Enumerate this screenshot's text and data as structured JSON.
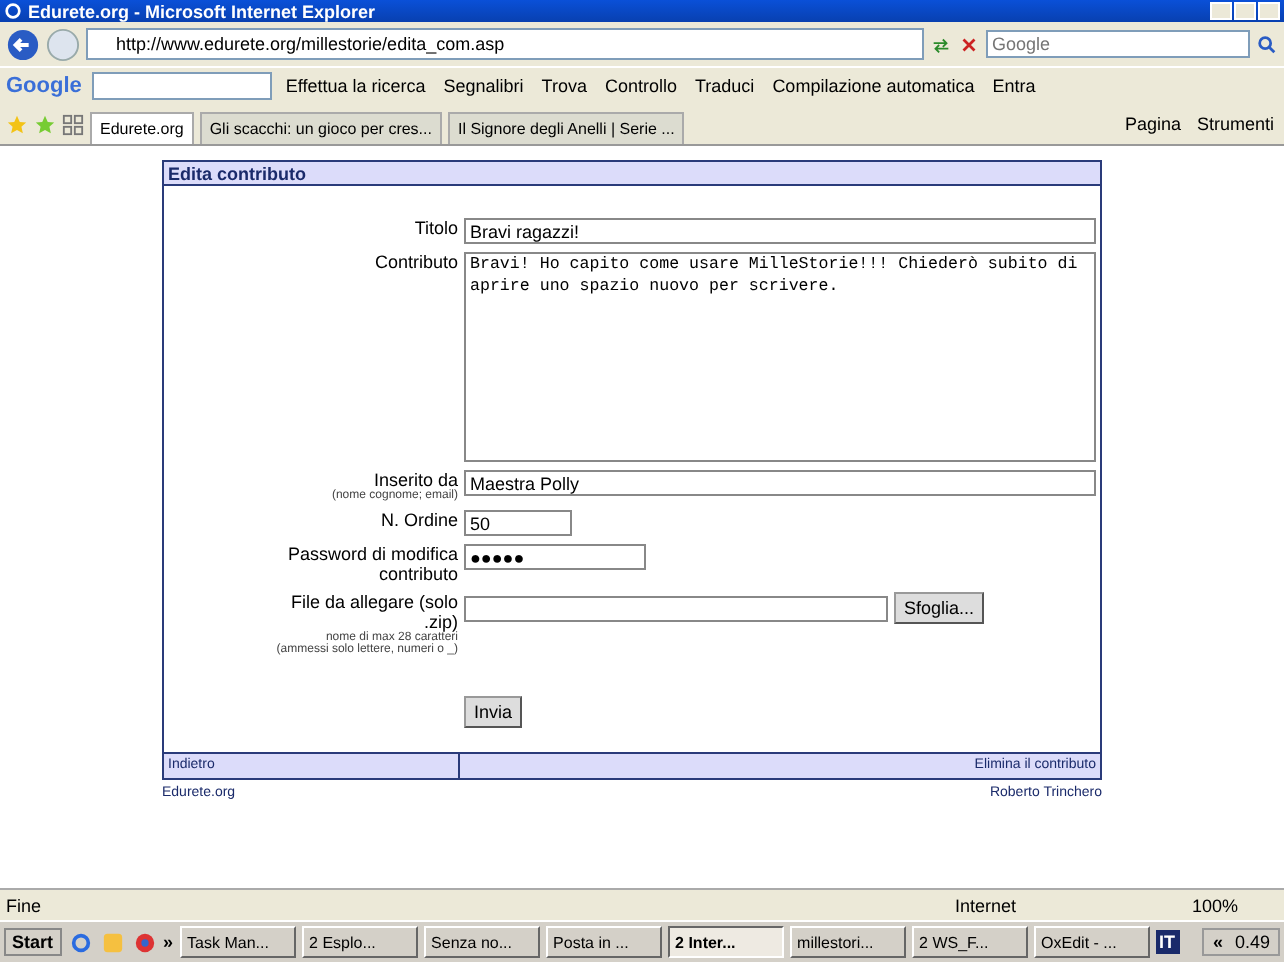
{
  "window": {
    "title": "Edurete.org - Microsoft Internet Explorer"
  },
  "address": {
    "url": "http://www.edurete.org/millestorie/edita_com.asp"
  },
  "search": {
    "placeholder": "Google"
  },
  "google_toolbar": {
    "logo": "Google",
    "search_button": "Effettua la ricerca",
    "items": [
      "Segnalibri",
      "Trova",
      "Controllo",
      "Traduci",
      "Compilazione automatica",
      "Entra"
    ]
  },
  "tabs": [
    {
      "label": "Edurete.org",
      "selected": true
    },
    {
      "label": "Gli scacchi: un gioco per cres...",
      "selected": false
    },
    {
      "label": "Il Signore degli Anelli | Serie ...",
      "selected": false
    }
  ],
  "command_bar": [
    "Pagina",
    "Strumenti"
  ],
  "form": {
    "header": "Edita contributo",
    "fields": [
      {
        "kind": "text",
        "label": "Titolo",
        "value": "Bravi ragazzi!"
      },
      {
        "kind": "textarea",
        "label": "Contributo",
        "value": "Bravi! Ho capito come usare MilleStorie!!! Chiederò subito di aprire uno spazio nuovo per scrivere."
      },
      {
        "kind": "text",
        "label": "Inserito da",
        "hint": "(nome cognome; email)",
        "value": "Maestra Polly"
      },
      {
        "kind": "short",
        "label": "N. Ordine",
        "value": "50"
      },
      {
        "kind": "password",
        "label": "Password di modifica contributo",
        "value": "●●●●●"
      },
      {
        "kind": "file",
        "label": "File da allegare (solo .zip)",
        "hint": "nome di max 28 caratteri",
        "hint2": "(ammessi solo lettere, numeri o _)",
        "button": "Sfoglia..."
      }
    ],
    "submit": "Invia",
    "footer_left": "Indietro",
    "footer_right": "Elimina il contributo"
  },
  "page_footer": {
    "left": "Edurete.org",
    "right": "Roberto Trinchero"
  },
  "status_bar": {
    "text": "Fine",
    "zone": "Internet",
    "zoom": "100%"
  },
  "taskbar": {
    "start": "Start",
    "more": "»",
    "items": [
      {
        "label": "Task Man...",
        "selected": false
      },
      {
        "label": "2 Esplo...",
        "selected": false
      },
      {
        "label": "Senza no...",
        "selected": false
      },
      {
        "label": "Posta in ...",
        "selected": false
      },
      {
        "label": "2 Inter...",
        "selected": true
      },
      {
        "label": "millestori...",
        "selected": false
      },
      {
        "label": "2 WS_F...",
        "selected": false
      },
      {
        "label": "OxEdit - ...",
        "selected": false
      }
    ],
    "language": "IT",
    "tray_toggle": "«",
    "clock": "0.49"
  }
}
